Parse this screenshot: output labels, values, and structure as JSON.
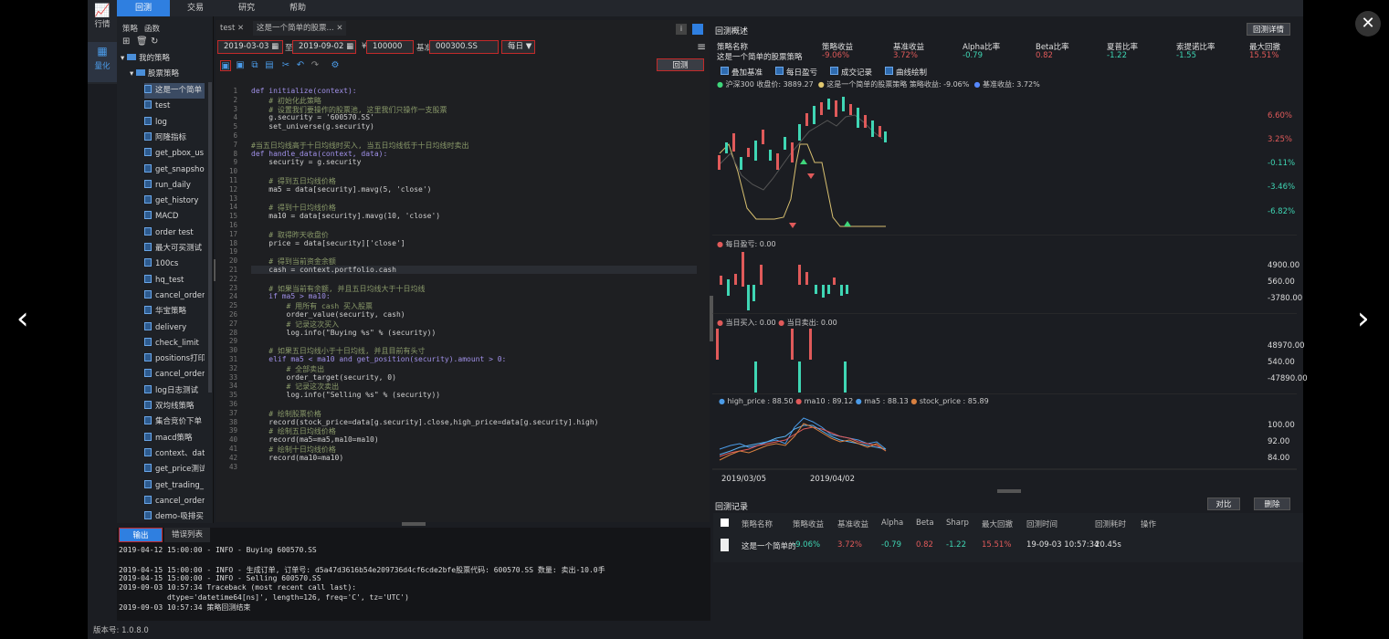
{
  "topbar": {
    "tabs": [
      "回测",
      "交易",
      "研究",
      "帮助"
    ]
  },
  "leftrail": {
    "items": [
      "行情",
      "量化"
    ]
  },
  "sidebar": {
    "tabs": [
      "策略",
      "函数"
    ],
    "root": "我的策略",
    "folder": "股票策略",
    "files": [
      "这是一个简单",
      "test",
      "log",
      "阿隆指标",
      "get_pbox_us",
      "get_snapsho",
      "run_daily",
      "get_history",
      "MACD",
      "order test",
      "最大可买测试",
      "100cs",
      "hq_test",
      "cancel_order",
      "华宝策略",
      "delivery",
      "check_limit",
      "positions打印",
      "cancel_order",
      "log日志测试",
      "双均线策略",
      "集合竞价下单",
      "macd策略",
      "context、dat",
      "get_price测试",
      "get_trading_",
      "cancel_order",
      "demo-吸排买"
    ]
  },
  "editor": {
    "tabs": [
      "test",
      "这是一个简单的股票..."
    ],
    "start_date": "2019-03-03",
    "to_label": "至",
    "end_date": "2019-09-02",
    "currency": "¥",
    "capital": "100000",
    "benchmark_label": "基准",
    "benchmark": "000300.SS",
    "frequency": "每日",
    "backtest_button": "回测",
    "save_hint": "保存",
    "code": [
      {
        "t": "def initialize(context):",
        "c": "kw"
      },
      {
        "t": "    # 初始化此策略",
        "c": "cm"
      },
      {
        "t": "    # 设置我们要操作的股票池, 这里我们只操作一支股票",
        "c": "cm"
      },
      {
        "t": "    g.security = '600570.SS'",
        "c": ""
      },
      {
        "t": "    set_universe(g.security)",
        "c": ""
      },
      {
        "t": "",
        "c": ""
      },
      {
        "t": "#当五日均线高于十日均线时买入, 当五日均线低于十日均线时卖出",
        "c": "cm"
      },
      {
        "t": "def handle_data(context, data):",
        "c": "kw"
      },
      {
        "t": "    security = g.security",
        "c": ""
      },
      {
        "t": "",
        "c": ""
      },
      {
        "t": "    # 得到五日均线价格",
        "c": "cm"
      },
      {
        "t": "    ma5 = data[security].mavg(5, 'close')",
        "c": ""
      },
      {
        "t": "",
        "c": ""
      },
      {
        "t": "    # 得到十日均线价格",
        "c": "cm"
      },
      {
        "t": "    ma10 = data[security].mavg(10, 'close')",
        "c": ""
      },
      {
        "t": "",
        "c": ""
      },
      {
        "t": "    # 取得昨天收盘价",
        "c": "cm"
      },
      {
        "t": "    price = data[security]['close']",
        "c": ""
      },
      {
        "t": "",
        "c": ""
      },
      {
        "t": "    # 得到当前资金余额",
        "c": "cm"
      },
      {
        "t": "    cash = context.portfolio.cash",
        "c": ""
      },
      {
        "t": "",
        "c": ""
      },
      {
        "t": "    # 如果当前有余额, 并且五日均线大于十日均线",
        "c": "cm"
      },
      {
        "t": "    if ma5 > ma10:",
        "c": "kw"
      },
      {
        "t": "        # 用所有 cash 买入股票",
        "c": "cm"
      },
      {
        "t": "        order_value(security, cash)",
        "c": ""
      },
      {
        "t": "        # 记录这次买入",
        "c": "cm"
      },
      {
        "t": "        log.info(\"Buying %s\" % (security))",
        "c": ""
      },
      {
        "t": "",
        "c": ""
      },
      {
        "t": "    # 如果五日均线小于十日均线, 并且目前有头寸",
        "c": "cm"
      },
      {
        "t": "    elif ma5 < ma10 and get_position(security).amount > 0:",
        "c": "kw"
      },
      {
        "t": "        # 全部卖出",
        "c": "cm"
      },
      {
        "t": "        order_target(security, 0)",
        "c": ""
      },
      {
        "t": "        # 记录这次卖出",
        "c": "cm"
      },
      {
        "t": "        log.info(\"Selling %s\" % (security))",
        "c": ""
      },
      {
        "t": "",
        "c": ""
      },
      {
        "t": "    # 绘制股票价格",
        "c": "cm"
      },
      {
        "t": "    record(stock_price=data[g.security].close,high_price=data[g.security].high)",
        "c": ""
      },
      {
        "t": "    # 绘制五日均线价格",
        "c": "cm"
      },
      {
        "t": "    record(ma5=ma5,ma10=ma10)",
        "c": ""
      },
      {
        "t": "    # 绘制十日均线价格",
        "c": "cm"
      },
      {
        "t": "    record(ma10=ma10)",
        "c": ""
      },
      {
        "t": "",
        "c": ""
      }
    ]
  },
  "console": {
    "tabs": [
      "输出",
      "错误列表"
    ],
    "lines": [
      "2019-04-12 15:00:00 - INFO - Buying 600570.SS",
      "",
      "2019-04-15 15:00:00 - INFO - 生成订单, 订单号: d5a47d3616b54e209736d4cf6cde2bfe股票代码: 600570.SS 数量: 卖出-10.0手",
      "2019-04-15 15:00:00 - INFO - Selling 600570.SS",
      "2019-09-03 10:57:34 Traceback (most recent call last):",
      "           dtype='datetime64[ns]', length=126, freq='C', tz='UTC')",
      "2019-09-03 10:57:34 策略回测结束"
    ]
  },
  "footer": {
    "version": "版本号: 1.0.8.0"
  },
  "overview": {
    "title": "回测概述",
    "detail_button": "回测详情",
    "headers": [
      "策略名称",
      "策略收益",
      "基准收益",
      "Alpha比率",
      "Beta比率",
      "夏普比率",
      "索提诺比率",
      "最大回撤"
    ],
    "values": [
      "这是一个简单的股票策略",
      "-9.06%",
      "3.72%",
      "-0.79",
      "0.82",
      "-1.22",
      "-1.55",
      "15.51%"
    ],
    "checkboxes": [
      "叠加基准",
      "每日盈亏",
      "成交记录",
      "曲线绘制"
    ]
  },
  "main_chart": {
    "legend1": "沪深300  收盘价: 3889.27",
    "legend2": "这是一个简单的股票策略  策略收益: -9.06%",
    "legend3": "基准收益: 3.72%",
    "y_ticks": [
      "6.60%",
      "3.25%",
      "-0.11%",
      "-3.46%",
      "-6.82%"
    ]
  },
  "pnl_chart": {
    "legend": "每日盈亏: 0.00",
    "y_ticks": [
      "4900.00",
      "560.00",
      "-3780.00"
    ]
  },
  "trade_chart": {
    "legend1": "当日买入: 0.00",
    "legend2": "当日卖出: 0.00",
    "y_ticks": [
      "48970.00",
      "540.00",
      "-47890.00"
    ]
  },
  "line_chart": {
    "legend": [
      "high_price : 88.50",
      "ma10 : 89.12",
      "ma5 : 88.13",
      "stock_price : 85.89"
    ],
    "y_ticks": [
      "100.00",
      "92.00",
      "84.00"
    ],
    "x_ticks": [
      "2019/03/05",
      "2019/04/02"
    ]
  },
  "records": {
    "title": "回测记录",
    "compare_button": "对比",
    "delete_button": "删除",
    "headers": [
      "策略名称",
      "策略收益",
      "基准收益",
      "Alpha",
      "Beta",
      "Sharp",
      "最大回撤",
      "回测时间",
      "回测耗时",
      "操作"
    ],
    "row": [
      "这是一个简单的",
      "-9.06%",
      "3.72%",
      "-0.79",
      "0.82",
      "-1.22",
      "15.51%",
      "19-09-03 10:57:34",
      "20.45s",
      ""
    ]
  },
  "colors": {
    "accent": "#2f7fe0",
    "up": "#e05a5a",
    "down": "#3fd6b4",
    "save_red": "#d23a3a"
  }
}
